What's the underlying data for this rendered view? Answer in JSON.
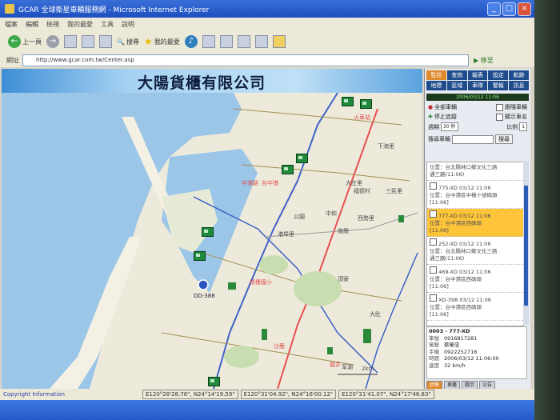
{
  "window": {
    "title": "GCAR 全球衛星車輛服務網 - Microsoft Internet Explorer"
  },
  "menu": [
    "檔案",
    "編輯",
    "檢視",
    "我的最愛",
    "工具",
    "說明"
  ],
  "toolbar": {
    "back": "上一頁",
    "search": "搜尋",
    "favorites": "我的最愛"
  },
  "address": {
    "label": "網址",
    "url": "http://www.gcar.com.tw/Center.asp",
    "go": "移至"
  },
  "banner": {
    "company": "大陽貨櫃有限公司"
  },
  "map": {
    "labels_red": [
      "火車站",
      "中港路",
      "台中港",
      "梧棲國小",
      "沙鹿",
      "龍井"
    ],
    "labels_dark": [
      "下湳里",
      "大庄里",
      "福德村",
      "三民里",
      "中和",
      "港埠里",
      "公園",
      "西勢里",
      "南簡",
      "頂寮",
      "大肚",
      "草湖"
    ],
    "marker_label": "DD-388",
    "scale": "2km"
  },
  "status": {
    "copyright": "Copyright Information",
    "coords": [
      "E120°28'28.76\", N24°14'19.59\"",
      "E120°31'04.92\", N24°16'00.12\"",
      "E120°31'41.07\", N24°17'46.83\""
    ]
  },
  "panel": {
    "tabs_top": [
      "監控",
      "查詢",
      "報表",
      "設定",
      "軌跡",
      "地標",
      "區域",
      "車隊",
      "警報",
      "訊息"
    ],
    "clock": "2006/03/12 11:06",
    "controls": {
      "all_vehicles": "全部車輛",
      "follow": "跟隨車輛",
      "stop_track": "停止追蹤",
      "show_name": "顯示車名",
      "interval_label": "週期",
      "interval_val": "30 秒",
      "zoom_label": "比例",
      "zoom_val": "1"
    },
    "search": {
      "label": "搜尋車輛",
      "button": "搜尋"
    },
    "vehicles": [
      {
        "loc": "位置：台北縣林口鄉文化三路",
        "sub": "通三路(11:06)",
        "hl": false
      },
      {
        "id": "775-XD",
        "time": "03/12 11:06",
        "loc": "位置：台中港區中橫十號碼頭",
        "sub": "[11:06]",
        "hl": false
      },
      {
        "id": "777-XD",
        "time": "03/12 11:06",
        "loc": "位置：台中港區西碼頭",
        "sub": "[11:06]",
        "hl": true
      },
      {
        "id": "252-XD",
        "time": "03/12 11:06",
        "loc": "位置：台北縣林口鄉文化三路",
        "sub": "通三路(11:06)",
        "hl": false
      },
      {
        "id": "469-XD",
        "time": "03/12 11:06",
        "loc": "位置：台中港區西碼頭",
        "sub": "[11:06]",
        "hl": false
      },
      {
        "id": "XD-398",
        "time": "03/12 11:06",
        "loc": "位置：台中港區西碼頭",
        "sub": "[11:06]",
        "hl": false
      }
    ],
    "info": {
      "header": "0003 - 777-XD",
      "rows": [
        {
          "k": "車號",
          "v": "0916817281"
        },
        {
          "k": "駕駛",
          "v": "蔡榮忠"
        },
        {
          "k": "手機",
          "v": "0922252716"
        },
        {
          "k": "時間",
          "v": "2006/03/12 11:06:00"
        },
        {
          "k": "速度",
          "v": "32 km/h"
        }
      ]
    },
    "tabs_bottom": [
      "狀態",
      "車籍",
      "圖示",
      "公告"
    ]
  }
}
